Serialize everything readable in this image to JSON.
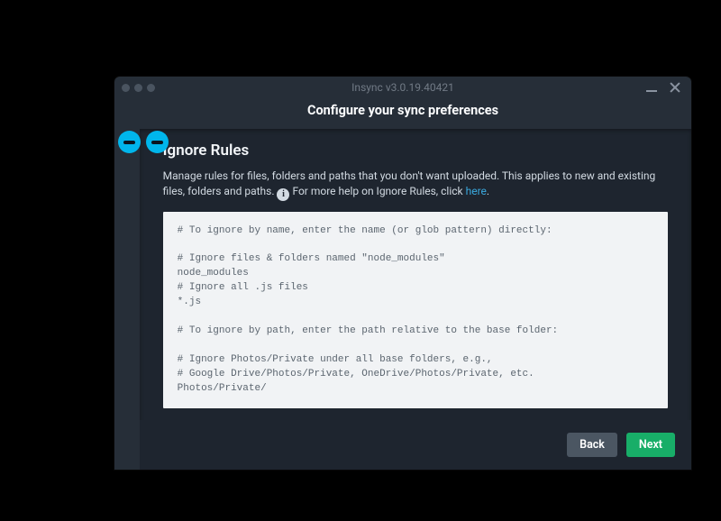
{
  "titlebar": {
    "title": "Insync v3.0.19.40421"
  },
  "subheader": {
    "title": "Configure your sync preferences"
  },
  "panel": {
    "section_title": "Ignore Rules",
    "desc_part1": "Manage rules for files, folders and paths that you don't want uploaded. This applies to new and existing files, folders and paths. ",
    "info_glyph": "i",
    "desc_part2": " For more help on Ignore Rules, click ",
    "link_text": "here",
    "desc_tail": "."
  },
  "rules_text": "# To ignore by name, enter the name (or glob pattern) directly:\n\n# Ignore files & folders named \"node_modules\"\nnode_modules\n# Ignore all .js files\n*.js\n\n# To ignore by path, enter the path relative to the base folder:\n\n# Ignore Photos/Private under all base folders, e.g.,\n# Google Drive/Photos/Private, OneDrive/Photos/Private, etc.\nPhotos/Private/",
  "buttons": {
    "back": "Back",
    "next": "Next"
  }
}
